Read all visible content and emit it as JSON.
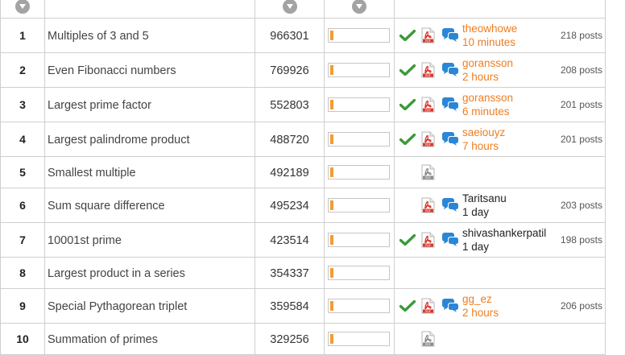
{
  "header": {
    "sort_icon_name": "chevron-down-icon"
  },
  "colors": {
    "accent": "#ee7d22",
    "difficulty_fill": "#f39c34",
    "check_green": "#3a9a3a",
    "chat_blue": "#2b86d6",
    "pdf_red": "#d9362b",
    "pdf_gray": "#8a8a8a"
  },
  "problems": [
    {
      "id": "1",
      "title": "Multiples of 3 and 5",
      "solved": "966301",
      "difficulty": 0.05,
      "solved_check": true,
      "pdf_active": true,
      "has_forum": true,
      "last_user": "theowhowe",
      "last_time": "10 minutes",
      "user_color": "orange",
      "posts": "218 posts"
    },
    {
      "id": "2",
      "title": "Even Fibonacci numbers",
      "solved": "769926",
      "difficulty": 0.05,
      "solved_check": true,
      "pdf_active": true,
      "has_forum": true,
      "last_user": "goransson",
      "last_time": "2 hours",
      "user_color": "orange",
      "posts": "208 posts"
    },
    {
      "id": "3",
      "title": "Largest prime factor",
      "solved": "552803",
      "difficulty": 0.05,
      "solved_check": true,
      "pdf_active": true,
      "has_forum": true,
      "last_user": "goransson",
      "last_time": "6 minutes",
      "user_color": "orange",
      "posts": "201 posts"
    },
    {
      "id": "4",
      "title": "Largest palindrome product",
      "solved": "488720",
      "difficulty": 0.05,
      "solved_check": true,
      "pdf_active": true,
      "has_forum": true,
      "last_user": "saeiouyz",
      "last_time": "7 hours",
      "user_color": "orange",
      "posts": "201 posts"
    },
    {
      "id": "5",
      "title": "Smallest multiple",
      "solved": "492189",
      "difficulty": 0.05,
      "solved_check": false,
      "pdf_active": false,
      "has_forum": false,
      "last_user": "",
      "last_time": "",
      "user_color": "orange",
      "posts": ""
    },
    {
      "id": "6",
      "title": "Sum square difference",
      "solved": "495234",
      "difficulty": 0.05,
      "solved_check": false,
      "pdf_active": true,
      "has_forum": true,
      "last_user": "Taritsanu",
      "last_time": "1 day",
      "user_color": "dark",
      "posts": "203 posts"
    },
    {
      "id": "7",
      "title": "10001st prime",
      "solved": "423514",
      "difficulty": 0.05,
      "solved_check": true,
      "pdf_active": true,
      "has_forum": true,
      "last_user": "shivashankerpatil",
      "last_time": "1 day",
      "user_color": "dark",
      "posts": "198 posts"
    },
    {
      "id": "8",
      "title": "Largest product in a series",
      "solved": "354337",
      "difficulty": 0.05,
      "solved_check": false,
      "pdf_active": false,
      "has_forum": false,
      "show_pdf": false,
      "last_user": "",
      "last_time": "",
      "user_color": "orange",
      "posts": ""
    },
    {
      "id": "9",
      "title": "Special Pythagorean triplet",
      "solved": "359584",
      "difficulty": 0.05,
      "solved_check": true,
      "pdf_active": true,
      "has_forum": true,
      "last_user": "gg_ez",
      "last_time": "2 hours",
      "user_color": "orange",
      "posts": "206 posts"
    },
    {
      "id": "10",
      "title": "Summation of primes",
      "solved": "329256",
      "difficulty": 0.05,
      "solved_check": false,
      "pdf_active": false,
      "has_forum": false,
      "last_user": "",
      "last_time": "",
      "user_color": "orange",
      "posts": ""
    }
  ]
}
